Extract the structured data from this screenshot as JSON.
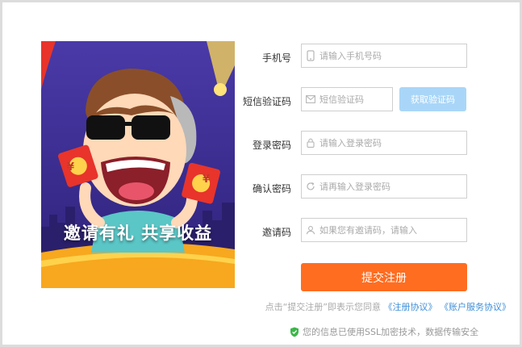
{
  "promo": {
    "slogan": "邀请有礼 共享收益",
    "coin_symbol": "¥"
  },
  "form": {
    "phone": {
      "label": "手机号",
      "placeholder": "请输入手机号码",
      "icon": "phone-icon"
    },
    "sms": {
      "label": "短信验证码",
      "placeholder": "短信验证码",
      "icon": "envelope-icon",
      "button": "获取验证码"
    },
    "password": {
      "label": "登录密码",
      "placeholder": "请输入登录密码",
      "icon": "lock-icon"
    },
    "confirm": {
      "label": "确认密码",
      "placeholder": "请再输入登录密码",
      "icon": "refresh-icon"
    },
    "invite": {
      "label": "邀请码",
      "placeholder": "如果您有邀请码，请输入",
      "icon": "user-icon"
    },
    "submit": "提交注册"
  },
  "agreement": {
    "prefix": "点击“提交注册”即表示您同意",
    "link1": "《注册协议》",
    "link2": "《账户服务协议》"
  },
  "security": {
    "text": "您的信息已使用SSL加密技术，数据传输安全",
    "icon": "shield-icon"
  },
  "colors": {
    "submit": "#ff6d21",
    "sms_button": "#a9d6f8",
    "link": "#3f8fd8",
    "shield": "#3cb64a"
  }
}
